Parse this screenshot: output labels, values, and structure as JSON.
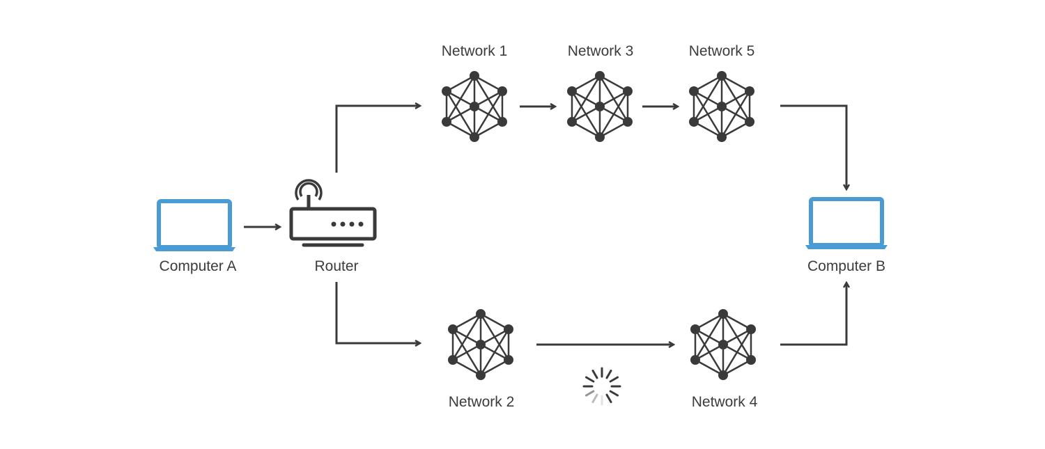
{
  "nodes": {
    "computer_a": {
      "label": "Computer A",
      "icon": "laptop-icon"
    },
    "router": {
      "label": "Router",
      "icon": "router-icon"
    },
    "computer_b": {
      "label": "Computer B",
      "icon": "laptop-icon"
    },
    "network1": {
      "label": "Network 1",
      "icon": "network-mesh-icon"
    },
    "network2": {
      "label": "Network 2",
      "icon": "network-mesh-icon"
    },
    "network3": {
      "label": "Network 3",
      "icon": "network-mesh-icon"
    },
    "network4": {
      "label": "Network 4",
      "icon": "network-mesh-icon"
    },
    "network5": {
      "label": "Network 5",
      "icon": "network-mesh-icon"
    }
  },
  "edges": [
    [
      "Computer A",
      "Router"
    ],
    [
      "Router",
      "Network 1"
    ],
    [
      "Network 1",
      "Network 3"
    ],
    [
      "Network 3",
      "Network 5"
    ],
    [
      "Network 5",
      "Computer B"
    ],
    [
      "Router",
      "Network 2"
    ],
    [
      "Network 2",
      "Network 4"
    ],
    [
      "Network 4",
      "Computer B"
    ]
  ],
  "loading_indicator": {
    "icon": "spinner-icon",
    "between": [
      "Network 2",
      "Network 4"
    ]
  },
  "colors": {
    "laptop": "#4a9ad4",
    "icon": "#3a3a3a",
    "text": "#3c3c3c"
  }
}
